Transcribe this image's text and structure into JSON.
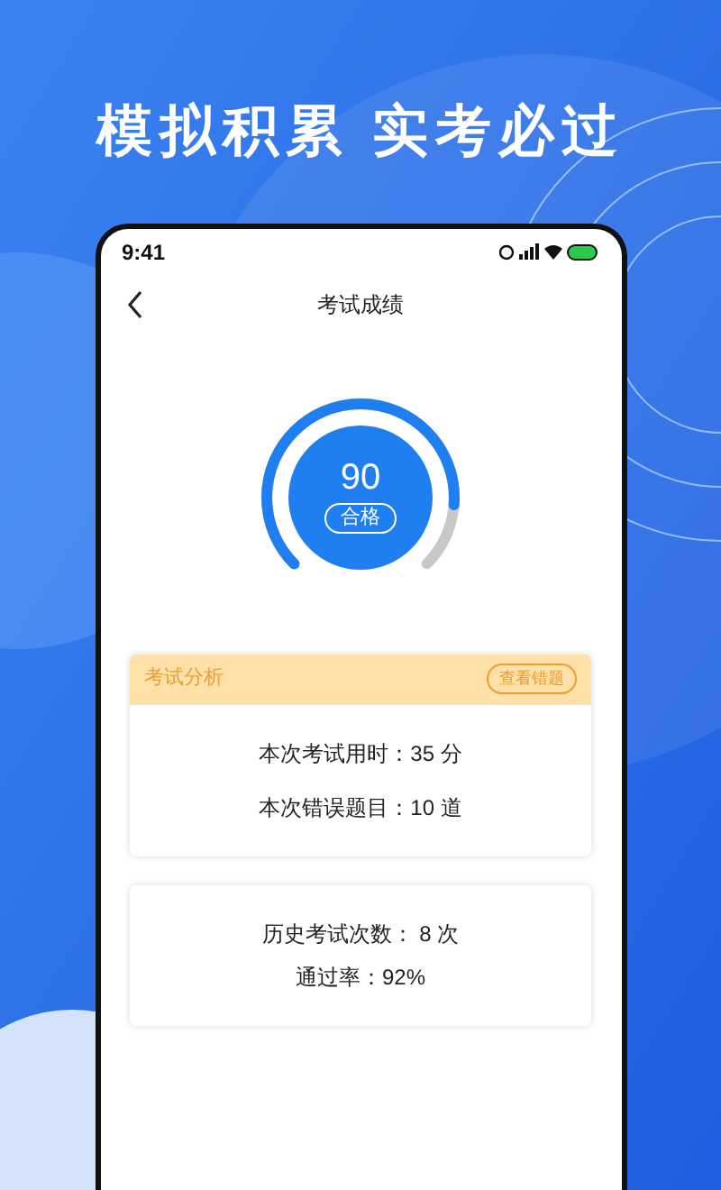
{
  "headline": "模拟积累 实考必过",
  "status_bar": {
    "time": "9:41"
  },
  "nav": {
    "title": "考试成绩"
  },
  "score": {
    "value": "90",
    "result": "合格",
    "level": 0.85
  },
  "analysis": {
    "title": "考试分析",
    "action": "查看错题",
    "lines": [
      "本次考试用时：35 分",
      "本次错误题目：10 道"
    ]
  },
  "history": {
    "lines": [
      "历史考试次数： 8 次",
      "通过率：92%"
    ]
  }
}
